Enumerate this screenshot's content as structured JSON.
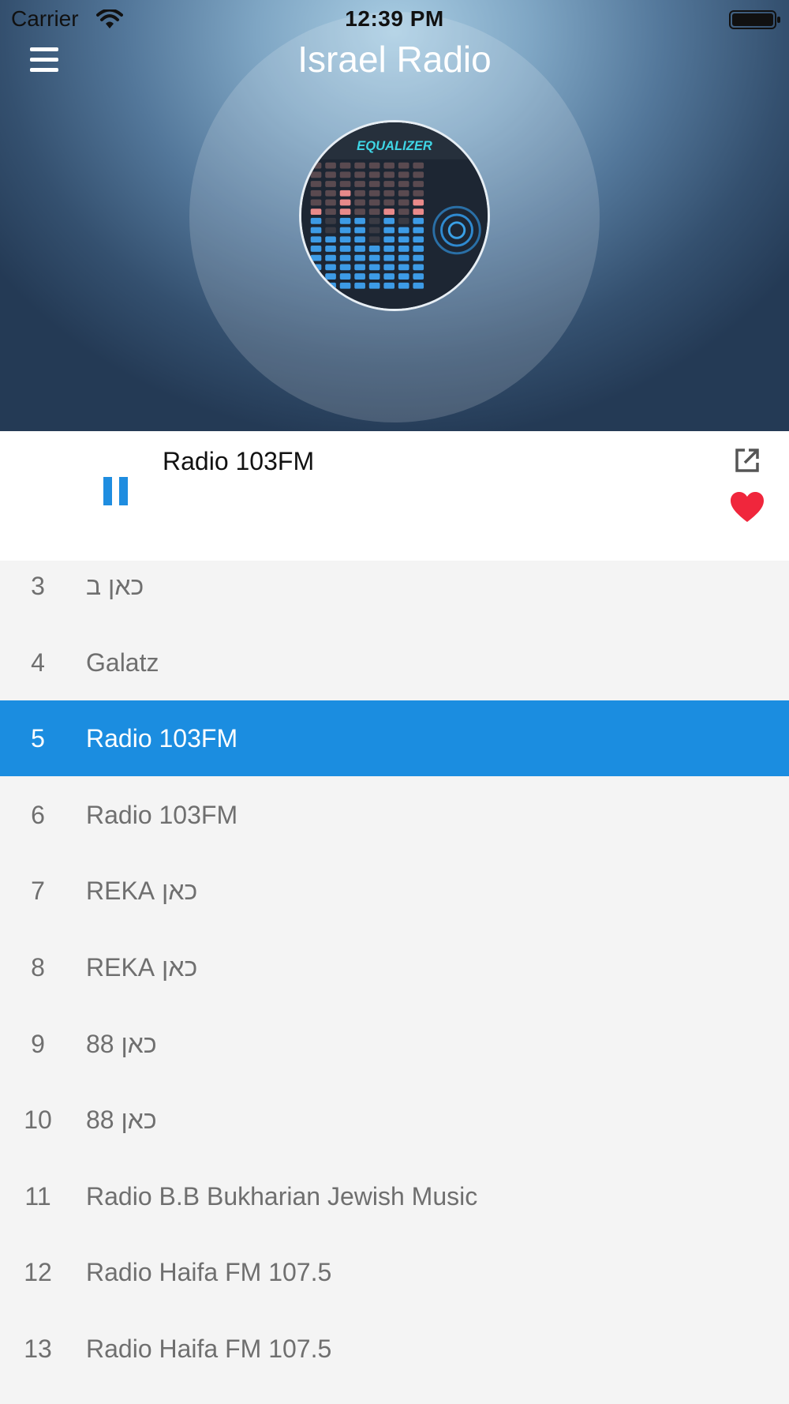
{
  "status_bar": {
    "carrier": "Carrier",
    "time": "12:39 PM"
  },
  "header": {
    "title": "Israel Radio",
    "artwork_caption": "EQUALIZER"
  },
  "now_playing": {
    "station": "Radio 103FM",
    "state": "playing"
  },
  "colors": {
    "accent": "#1b8de0",
    "heart": "#f0263c"
  },
  "stations": [
    {
      "num": "3",
      "name": "כאן ב",
      "active": false
    },
    {
      "num": "4",
      "name": "Galatz",
      "active": false
    },
    {
      "num": "5",
      "name": "Radio 103FM",
      "active": true
    },
    {
      "num": "6",
      "name": "Radio 103FM",
      "active": false
    },
    {
      "num": "7",
      "name": "כאן REKA",
      "active": false
    },
    {
      "num": "8",
      "name": "כאן REKA",
      "active": false
    },
    {
      "num": "9",
      "name": "כאן 88",
      "active": false
    },
    {
      "num": "10",
      "name": "כאן 88",
      "active": false
    },
    {
      "num": "11",
      "name": "Radio B.B Bukharian Jewish Music",
      "active": false
    },
    {
      "num": "12",
      "name": "Radio Haifa FM 107.5",
      "active": false
    },
    {
      "num": "13",
      "name": "Radio Haifa FM 107.5",
      "active": false
    }
  ]
}
